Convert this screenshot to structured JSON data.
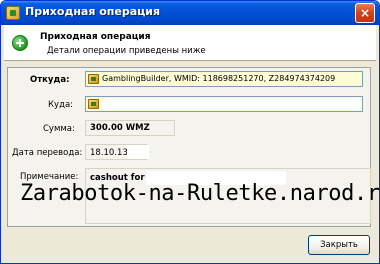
{
  "window": {
    "title": "Приходная операция"
  },
  "header": {
    "title": "Приходная операция",
    "subtitle": "Детали операции приведены ниже"
  },
  "form": {
    "from_label": "Откуда:",
    "from_value": "GamblingBuilder, WMID: 118698251270, Z284974374209",
    "to_label": "Куда:",
    "to_value": "",
    "sum_label": "Сумма:",
    "sum_value": "300.00 WMZ",
    "date_label": "Дата перевода:",
    "date_value": "18.10.13",
    "note_label": "Примечание:",
    "note_value": "cashout for"
  },
  "watermark": "Zarabotok-na-Ruletke.narod.ru",
  "buttons": {
    "close_label": "Закрыть",
    "title_close": "×"
  },
  "icons": {
    "app": "webmoney-wallet-icon",
    "header": "add-plus-icon",
    "purse": "purse-icon"
  },
  "colors": {
    "title_bar": "#0150d6",
    "field_bg": "#fefbd7",
    "header_icon": "#1f9a1f"
  }
}
